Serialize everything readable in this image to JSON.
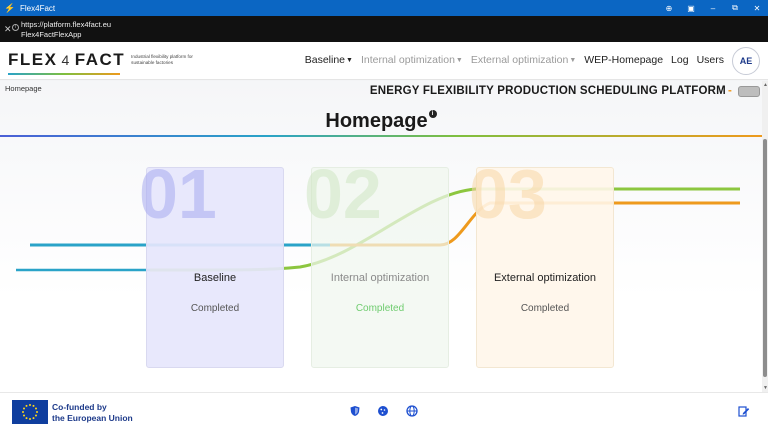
{
  "window": {
    "title": "Flex4Fact",
    "url": "https://platform.flex4fact.eu",
    "site_name": "Flex4FactFlexApp"
  },
  "header": {
    "logo_text_left": "FLEX",
    "logo_text_mid": "4",
    "logo_text_right": "FACT",
    "tagline": "Industrial flexibility platform for sustainable factories",
    "nav": [
      {
        "label": "Baseline",
        "has_menu": true,
        "muted": false
      },
      {
        "label": "Internal optimization",
        "has_menu": true,
        "muted": true
      },
      {
        "label": "External optimization",
        "has_menu": true,
        "muted": true
      },
      {
        "label": "WEP-Homepage",
        "has_menu": false,
        "muted": false
      },
      {
        "label": "Log",
        "has_menu": false,
        "muted": false
      },
      {
        "label": "Users",
        "has_menu": false,
        "muted": false
      }
    ],
    "avatar_initials": "AE"
  },
  "content": {
    "breadcrumb": "Homepage",
    "platform_title": "ENERGY FLEXIBILITY PRODUCTION SCHEDULING PLATFORM",
    "platform_title_suffix": "-",
    "page_title": "Homepage",
    "info_badge": "i",
    "cards": [
      {
        "number": "01",
        "label": "Baseline",
        "status": "Completed"
      },
      {
        "number": "02",
        "label": "Internal optimization",
        "status": "Completed"
      },
      {
        "number": "03",
        "label": "External optimization",
        "status": "Completed"
      }
    ]
  },
  "footer": {
    "eu_line1": "Co-funded by",
    "eu_line2": "the European Union"
  },
  "colors": {
    "accent_blue": "#2aa3c8",
    "accent_green": "#8cc63f",
    "accent_orange": "#ee9a1d",
    "footer_blue": "#1d3a8a"
  },
  "icons": [
    "app-icon",
    "info-icon",
    "chevron-down-icon",
    "shield-icon",
    "cookie-icon",
    "globe-icon",
    "edit-icon"
  ]
}
